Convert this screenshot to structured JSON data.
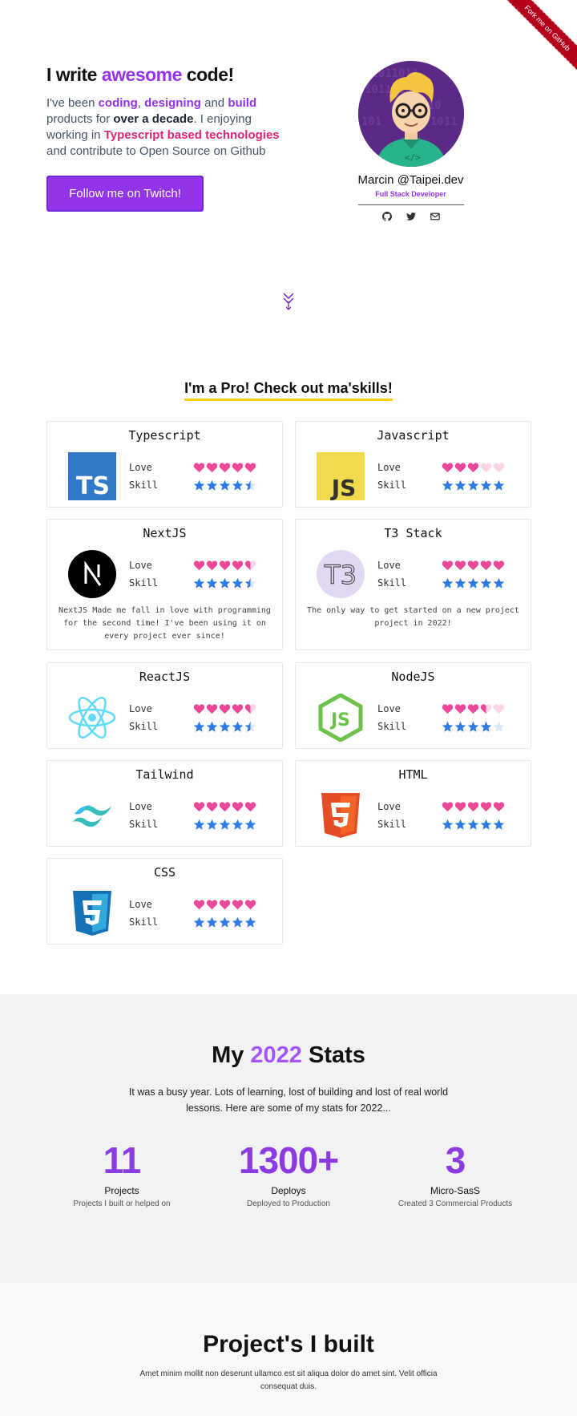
{
  "ribbon": {
    "label": "Fork me on GitHub"
  },
  "hero": {
    "title_pre": "I write ",
    "title_highlight": "awesome",
    "title_post": " code!",
    "text": {
      "p1": "I've been ",
      "coding": "coding",
      "comma": ", ",
      "designing": "designing",
      "and": " and ",
      "build": "build",
      "p2": " products for ",
      "decade": "over a decade",
      "p3": ". I enjoying working in ",
      "ts": "Typescript based technologies",
      "p4": " and contribute to Open Source on Github"
    },
    "button_label": "Follow me on Twitch!"
  },
  "profile": {
    "name": "Marcin @Taipei.dev",
    "role": "Full Stack Developer",
    "socials": [
      "github-icon",
      "twitter-icon",
      "mail-icon"
    ]
  },
  "skills": {
    "title": "I'm a Pro! Check out ma'skills!",
    "love_label": "Love",
    "skill_label": "Skill",
    "items": [
      {
        "name": "Typescript",
        "love": 5,
        "skill": 4.5,
        "desc": ""
      },
      {
        "name": "Javascript",
        "love": 3,
        "skill": 5,
        "desc": ""
      },
      {
        "name": "NextJS",
        "love": 4.5,
        "skill": 4.5,
        "desc": "NextJS Made me fall in love with programming for the second time! I've been using it on every project ever since!"
      },
      {
        "name": "T3 Stack",
        "love": 5,
        "skill": 5,
        "desc": "The only way to get started on a new project project in 2022!"
      },
      {
        "name": "ReactJS",
        "love": 4.5,
        "skill": 4.5,
        "desc": ""
      },
      {
        "name": "NodeJS",
        "love": 3.5,
        "skill": 4,
        "desc": ""
      },
      {
        "name": "Tailwind",
        "love": 5,
        "skill": 5,
        "desc": ""
      },
      {
        "name": "HTML",
        "love": 5,
        "skill": 5,
        "desc": ""
      },
      {
        "name": "CSS",
        "love": 5,
        "skill": 5,
        "desc": ""
      }
    ]
  },
  "stats": {
    "title_pre": "My ",
    "title_year": "2022",
    "title_post": " Stats",
    "desc": "It was a busy year. Lots of learning, lost of building and lost of real world lessons. Here are some of my stats for 2022...",
    "items": [
      {
        "value": "11",
        "label": "Projects",
        "sub": "Projects I built or helped on"
      },
      {
        "value": "1300+",
        "label": "Deploys",
        "sub": "Deployed to Production"
      },
      {
        "value": "3",
        "label": "Micro-SasS",
        "sub": "Created 3 Commercial Products"
      }
    ]
  },
  "projects": {
    "title": "Project's I built",
    "desc": "Amet minim mollit non deserunt ullamco est sit aliqua dolor do amet sint. Velit officia consequat duis."
  },
  "colors": {
    "accent": "#9333ea",
    "pink": "#db2777",
    "heart": "#ec4899",
    "star": "#2f7be5",
    "underline": "#facc15"
  }
}
